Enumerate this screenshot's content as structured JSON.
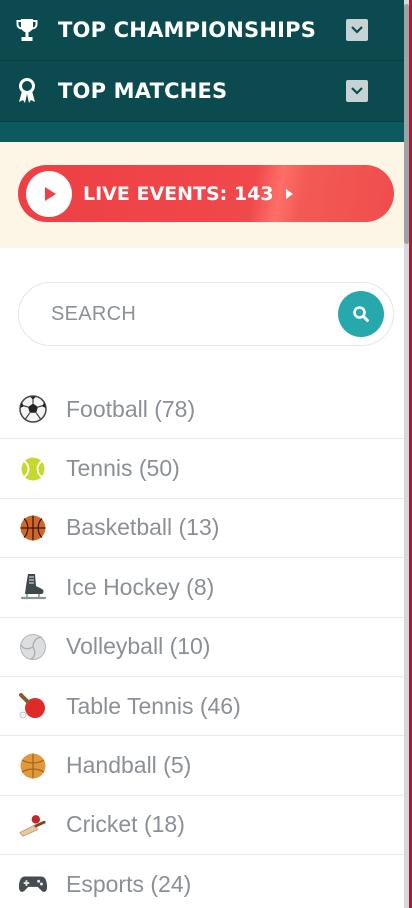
{
  "header": {
    "rows": [
      {
        "icon": "trophy-icon",
        "title": "TOP CHAMPIONSHIPS"
      },
      {
        "icon": "medal-icon",
        "title": "TOP MATCHES"
      }
    ]
  },
  "live": {
    "label": "LIVE EVENTS: 143",
    "icon": "play-icon"
  },
  "search": {
    "placeholder": "SEARCH",
    "value": ""
  },
  "sports": [
    {
      "label": "Football (78)",
      "icon": "soccer-ball-icon"
    },
    {
      "label": "Tennis (50)",
      "icon": "tennis-ball-icon"
    },
    {
      "label": "Basketball (13)",
      "icon": "basketball-icon"
    },
    {
      "label": "Ice Hockey (8)",
      "icon": "ice-skate-icon"
    },
    {
      "label": "Volleyball (10)",
      "icon": "volleyball-icon"
    },
    {
      "label": "Table Tennis (46)",
      "icon": "ping-pong-paddle-icon"
    },
    {
      "label": "Handball (5)",
      "icon": "handball-icon"
    },
    {
      "label": "Cricket (18)",
      "icon": "cricket-bat-icon"
    },
    {
      "label": "Esports (24)",
      "icon": "gamepad-icon"
    }
  ],
  "colors": {
    "header_bg": "#0b4b4f",
    "live_red": "#ee3f44",
    "search_teal": "#27a8ad",
    "outer_red": "#b11735"
  }
}
